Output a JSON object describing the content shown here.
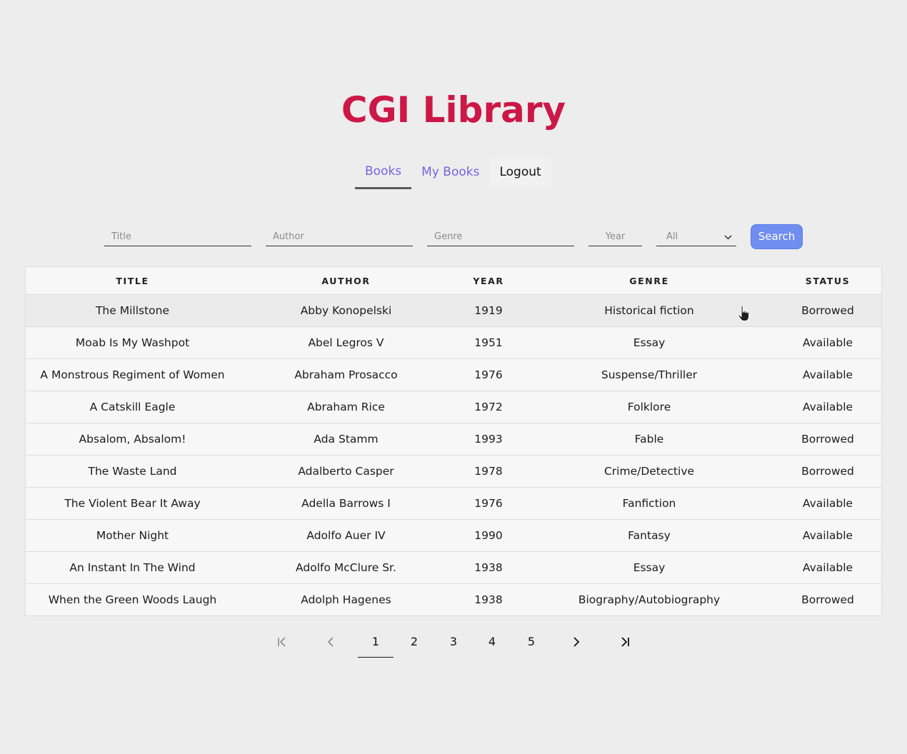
{
  "app": {
    "title": "CGI Library"
  },
  "nav": {
    "books": "Books",
    "my_books": "My Books",
    "logout": "Logout"
  },
  "filters": {
    "title_placeholder": "Title",
    "author_placeholder": "Author",
    "genre_placeholder": "Genre",
    "year_placeholder": "Year",
    "status_selected": "All",
    "search_label": "Search"
  },
  "table": {
    "headers": {
      "title": "TITLE",
      "author": "AUTHOR",
      "year": "YEAR",
      "genre": "GENRE",
      "status": "STATUS"
    },
    "rows": [
      {
        "title": "The Millstone",
        "author": "Abby Konopelski",
        "year": "1919",
        "genre": "Historical fiction",
        "status": "Borrowed"
      },
      {
        "title": "Moab Is My Washpot",
        "author": "Abel Legros V",
        "year": "1951",
        "genre": "Essay",
        "status": "Available"
      },
      {
        "title": "A Monstrous Regiment of Women",
        "author": "Abraham Prosacco",
        "year": "1976",
        "genre": "Suspense/Thriller",
        "status": "Available"
      },
      {
        "title": "A Catskill Eagle",
        "author": "Abraham Rice",
        "year": "1972",
        "genre": "Folklore",
        "status": "Available"
      },
      {
        "title": "Absalom, Absalom!",
        "author": "Ada Stamm",
        "year": "1993",
        "genre": "Fable",
        "status": "Borrowed"
      },
      {
        "title": "The Waste Land",
        "author": "Adalberto Casper",
        "year": "1978",
        "genre": "Crime/Detective",
        "status": "Borrowed"
      },
      {
        "title": "The Violent Bear It Away",
        "author": "Adella Barrows I",
        "year": "1976",
        "genre": "Fanfiction",
        "status": "Available"
      },
      {
        "title": "Mother Night",
        "author": "Adolfo Auer IV",
        "year": "1990",
        "genre": "Fantasy",
        "status": "Available"
      },
      {
        "title": "An Instant In The Wind",
        "author": "Adolfo McClure Sr.",
        "year": "1938",
        "genre": "Essay",
        "status": "Available"
      },
      {
        "title": "When the Green Woods Laugh",
        "author": "Adolph Hagenes",
        "year": "1938",
        "genre": "Biography/Autobiography",
        "status": "Borrowed"
      }
    ]
  },
  "pagination": {
    "pages": [
      "1",
      "2",
      "3",
      "4",
      "5"
    ],
    "current": "1",
    "icons": [
      "first-page-icon",
      "previous-page-icon",
      "next-page-icon",
      "last-page-icon"
    ]
  },
  "colors": {
    "title": "#cc1846",
    "nav_link": "#7563e0",
    "search_button": "#6f8ef0"
  }
}
